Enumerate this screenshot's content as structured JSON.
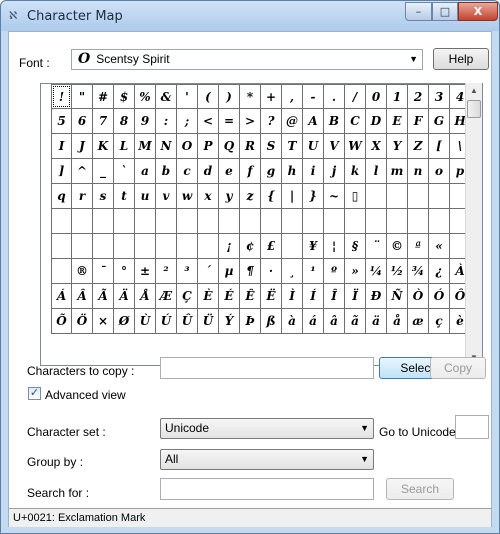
{
  "window": {
    "title": "Character Map",
    "app_icon": "charmap-icon"
  },
  "titlebar_buttons": {
    "minimize": "–",
    "maximize": "□",
    "close": "X"
  },
  "font": {
    "label": "Font :",
    "selected": "Scentsy Spirit",
    "icon_glyph": "O",
    "help_label": "Help"
  },
  "characters": [
    "!",
    "\"",
    "#",
    "$",
    "%",
    "&",
    "'",
    "(",
    ")",
    "*",
    "+",
    ",",
    "-",
    ".",
    "/",
    "0",
    "1",
    "2",
    "3",
    "4",
    "5",
    "6",
    "7",
    "8",
    "9",
    ":",
    ";",
    "<",
    "=",
    ">",
    "?",
    "@",
    "A",
    "B",
    "C",
    "D",
    "E",
    "F",
    "G",
    "H",
    "I",
    "J",
    "K",
    "L",
    "M",
    "N",
    "O",
    "P",
    "Q",
    "R",
    "S",
    "T",
    "U",
    "V",
    "W",
    "X",
    "Y",
    "Z",
    "[",
    "\\",
    "]",
    "^",
    "_",
    "`",
    "a",
    "b",
    "c",
    "d",
    "e",
    "f",
    "g",
    "h",
    "i",
    "j",
    "k",
    "l",
    "m",
    "n",
    "o",
    "p",
    "q",
    "r",
    "s",
    "t",
    "u",
    "v",
    "w",
    "x",
    "y",
    "z",
    "{",
    "|",
    "}",
    "~",
    "▯",
    "",
    "",
    "",
    "",
    "",
    "",
    "",
    "",
    "",
    "",
    "",
    "",
    "",
    "",
    "",
    "",
    "",
    "",
    "",
    "",
    "",
    "",
    "",
    "",
    "",
    "",
    "",
    "",
    "",
    "",
    "",
    "",
    "",
    "¡",
    "¢",
    "£",
    "",
    "¥",
    "¦",
    "§",
    "¨",
    "©",
    "ª",
    "«",
    "",
    "",
    "®",
    "¯",
    "°",
    "±",
    "²",
    "³",
    "´",
    "µ",
    "¶",
    "·",
    "¸",
    "¹",
    "º",
    "»",
    "¼",
    "½",
    "¾",
    "¿",
    "À",
    "Á",
    "Â",
    "Ã",
    "Ä",
    "Å",
    "Æ",
    "Ç",
    "È",
    "É",
    "Ê",
    "Ë",
    "Ì",
    "Í",
    "Î",
    "Ï",
    "Ð",
    "Ñ",
    "Ò",
    "Ó",
    "Ô",
    "Õ",
    "Ö",
    "×",
    "Ø",
    "Ù",
    "Ú",
    "Û",
    "Ü",
    "Ý",
    "Þ",
    "ß",
    "à",
    "á",
    "â",
    "ã",
    "ä",
    "å",
    "æ",
    "ç",
    "è"
  ],
  "copy": {
    "label": "Characters to copy :",
    "value": "",
    "select_label": "Select",
    "copy_label": "Copy"
  },
  "advanced": {
    "label": "Advanced view",
    "checked": true
  },
  "charset": {
    "label": "Character set :",
    "value": "Unicode",
    "goto_label": "Go to Unicode :",
    "goto_value": ""
  },
  "groupby": {
    "label": "Group by :",
    "value": "All"
  },
  "search": {
    "label": "Search for :",
    "value": "",
    "button_label": "Search"
  },
  "status": {
    "text": "U+0021: Exclamation Mark"
  }
}
